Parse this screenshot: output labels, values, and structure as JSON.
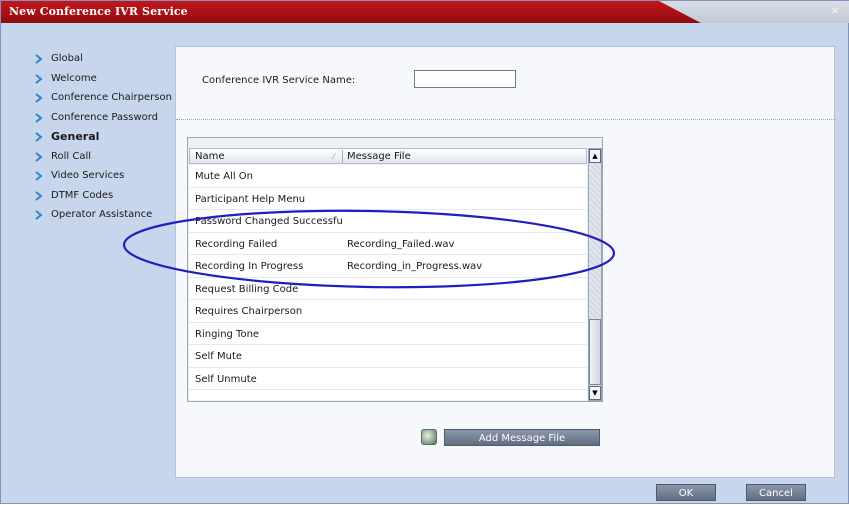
{
  "window": {
    "title": "New Conference IVR Service",
    "close_label": "×"
  },
  "nav": {
    "items": [
      {
        "label": "Global"
      },
      {
        "label": "Welcome"
      },
      {
        "label": "Conference Chairperson"
      },
      {
        "label": "Conference Password"
      },
      {
        "label": "General",
        "active": true
      },
      {
        "label": "Roll Call"
      },
      {
        "label": "Video Services"
      },
      {
        "label": "DTMF Codes"
      },
      {
        "label": "Operator Assistance"
      }
    ]
  },
  "form": {
    "service_name_label": "Conference IVR Service Name:",
    "service_name_value": ""
  },
  "grid": {
    "columns": [
      "Name",
      "Message File"
    ],
    "rows": [
      {
        "name": "Mute All On",
        "file": ""
      },
      {
        "name": "Participant Help Menu",
        "file": ""
      },
      {
        "name": "Password Changed Successfu",
        "file": ""
      },
      {
        "name": "Recording Failed",
        "file": "Recording_Failed.wav"
      },
      {
        "name": "Recording In Progress",
        "file": "Recording_in_Progress.wav"
      },
      {
        "name": "Request Billing Code",
        "file": ""
      },
      {
        "name": "Requires Chairperson",
        "file": ""
      },
      {
        "name": "Ringing Tone",
        "file": ""
      },
      {
        "name": "Self Mute",
        "file": ""
      },
      {
        "name": "Self Unmute",
        "file": ""
      }
    ]
  },
  "actions": {
    "add_message_file": "Add Message File",
    "ok": "OK",
    "cancel": "Cancel"
  },
  "colors": {
    "title_bar": "#b01216",
    "background": "#c7d6ec",
    "button": "#6f7b8e",
    "annotation": "#1f1fbf"
  }
}
